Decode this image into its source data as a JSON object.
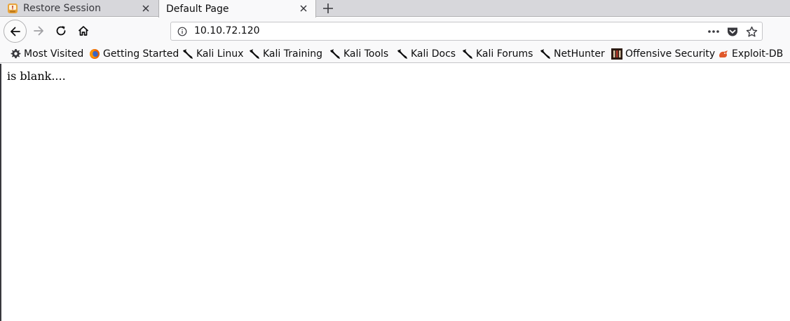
{
  "tabs": [
    {
      "title": "Restore Session",
      "icon": "restore-session-icon",
      "active": false
    },
    {
      "title": "Default Page",
      "icon": "",
      "active": true
    }
  ],
  "nav": {
    "url": "10.10.72.120"
  },
  "bookmarks": [
    {
      "label": "Most Visited",
      "icon": "gear-icon"
    },
    {
      "label": "Getting Started",
      "icon": "firefox-icon"
    },
    {
      "label": "Kali Linux",
      "icon": "kali-dragon-icon"
    },
    {
      "label": "Kali Training",
      "icon": "kali-dragon-icon"
    },
    {
      "label": "Kali Tools",
      "icon": "kali-dragon-icon"
    },
    {
      "label": "Kali Docs",
      "icon": "kali-dragon-icon"
    },
    {
      "label": "Kali Forums",
      "icon": "kali-dragon-icon"
    },
    {
      "label": "NetHunter",
      "icon": "kali-dragon-icon"
    },
    {
      "label": "Offensive Security",
      "icon": "offsec-icon"
    },
    {
      "label": "Exploit-DB",
      "icon": "exploit-db-icon"
    }
  ],
  "page": {
    "body_text": "is blank...."
  },
  "colors": {
    "tabstrip_bg": "#d7d7db",
    "toolbar_bg": "#f9f9fa",
    "restore_icon": "#e8a33c",
    "firefox_orange": "#e66000",
    "exploit_db": "#e0572a"
  }
}
